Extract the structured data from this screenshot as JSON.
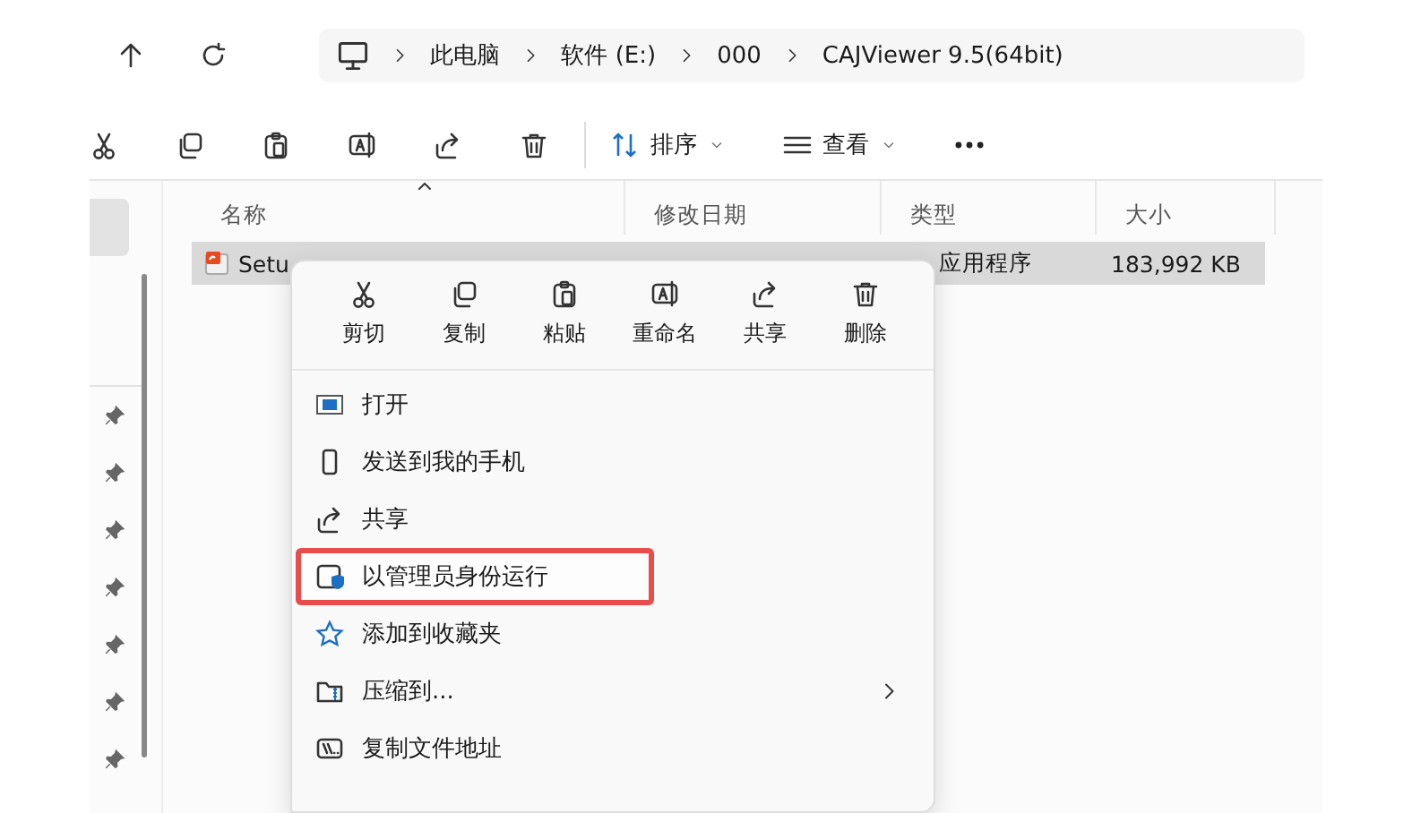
{
  "address_bar": {
    "crumbs": [
      "此电脑",
      "软件 (E:)",
      "000",
      "CAJViewer 9.5(64bit)"
    ]
  },
  "toolbar": {
    "icon_buttons": [
      {
        "kind": "cut"
      },
      {
        "kind": "copy"
      },
      {
        "kind": "paste"
      },
      {
        "kind": "rename"
      },
      {
        "kind": "share"
      },
      {
        "kind": "delete"
      }
    ],
    "menus": [
      {
        "kind": "sort",
        "label": "排序"
      },
      {
        "kind": "view",
        "label": "查看"
      }
    ]
  },
  "sidebar": {
    "items": [
      {
        "selected": true,
        "pinned": false
      },
      {
        "selected": false,
        "pinned": true
      },
      {
        "selected": false,
        "pinned": true
      },
      {
        "selected": false,
        "pinned": true
      },
      {
        "selected": false,
        "pinned": true
      },
      {
        "selected": false,
        "pinned": true
      },
      {
        "selected": false,
        "pinned": true
      },
      {
        "selected": false,
        "pinned": true
      }
    ]
  },
  "file_list": {
    "columns": [
      {
        "label": "名称",
        "sorted": true
      },
      {
        "label": "修改日期",
        "sorted": false
      },
      {
        "label": "类型",
        "sorted": false
      },
      {
        "label": "大小",
        "sorted": false
      }
    ],
    "rows": [
      {
        "name": "Setu",
        "type": "应用程序",
        "size": "183,992 KB",
        "selected": true
      }
    ]
  },
  "context_menu": {
    "actions": [
      {
        "kind": "cut",
        "label": "剪切"
      },
      {
        "kind": "copy",
        "label": "复制"
      },
      {
        "kind": "paste",
        "label": "粘贴"
      },
      {
        "kind": "rename",
        "label": "重命名"
      },
      {
        "kind": "share",
        "label": "共享"
      },
      {
        "kind": "delete",
        "label": "删除"
      }
    ],
    "items": [
      {
        "kind": "open",
        "label": "打开",
        "highlighted": false,
        "submenu": false
      },
      {
        "kind": "phone",
        "label": "发送到我的手机",
        "highlighted": false,
        "submenu": false
      },
      {
        "kind": "share",
        "label": "共享",
        "highlighted": false,
        "submenu": false
      },
      {
        "kind": "admin",
        "label": "以管理员身份运行",
        "highlighted": true,
        "submenu": false
      },
      {
        "kind": "favorite",
        "label": "添加到收藏夹",
        "highlighted": false,
        "submenu": false
      },
      {
        "kind": "zip",
        "label": "压缩到...",
        "highlighted": false,
        "submenu": true
      },
      {
        "kind": "path",
        "label": "复制文件地址",
        "highlighted": false,
        "submenu": false
      }
    ]
  }
}
